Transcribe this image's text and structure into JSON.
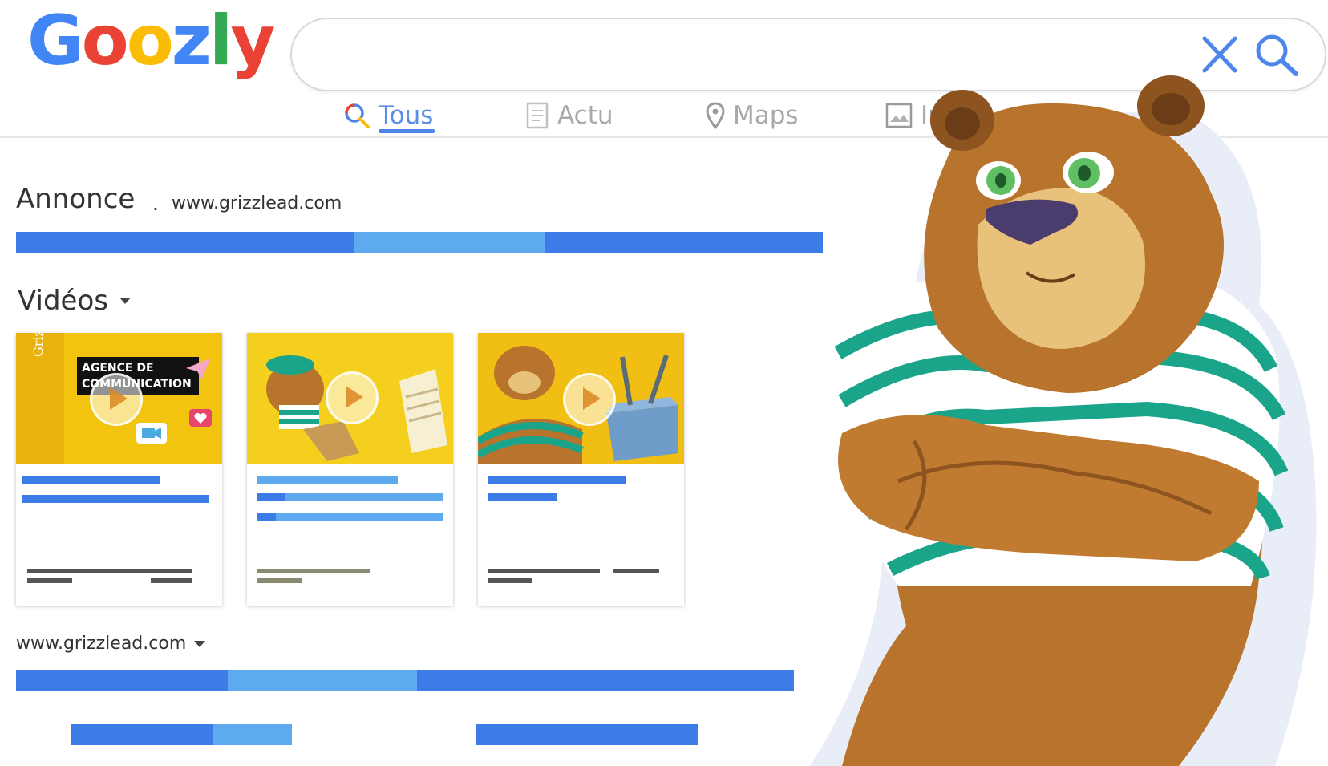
{
  "logo": {
    "letters": [
      "G",
      "o",
      "o",
      "z",
      "l",
      "y"
    ],
    "colors": [
      "#4285f4",
      "#ea4335",
      "#fbbc05",
      "#4285f4",
      "#34a853",
      "#ea4335"
    ]
  },
  "search": {
    "value": "",
    "placeholder": ""
  },
  "tabs": [
    {
      "label": "Tous",
      "icon": "search-icon",
      "active": true
    },
    {
      "label": "Actu",
      "icon": "news-icon",
      "active": false
    },
    {
      "label": "Maps",
      "icon": "map-pin-icon",
      "active": false
    },
    {
      "label": "Imag",
      "icon": "image-icon",
      "active": false
    }
  ],
  "ad": {
    "label": "Annonce",
    "separator": ".",
    "url": "www.grizzlead.com"
  },
  "videos": {
    "heading": "Vidéos",
    "cards": [
      {
        "thumb_title": "AGENCE DE COMMUNICATION",
        "brand": "Grizzlead"
      },
      {
        "thumb_title": ""
      },
      {
        "thumb_title": ""
      }
    ]
  },
  "result": {
    "url": "www.grizzlead.com"
  },
  "colors": {
    "accent_dark": "#3d7be8",
    "accent_light": "#5eaaf0",
    "thumb_yellow": "#f2c30f",
    "bear_brown": "#b8742d",
    "stripe_green": "#1aa58a"
  }
}
